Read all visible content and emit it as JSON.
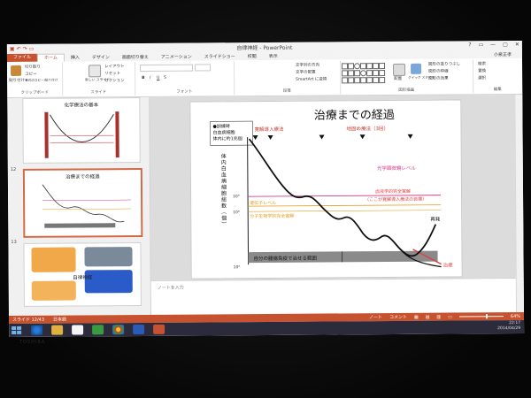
{
  "window": {
    "title": "自律神経 - PowerPoint",
    "controls": [
      "?",
      "▭",
      "—",
      "▢",
      "✕"
    ],
    "qat_icons": [
      "save-icon",
      "undo-icon",
      "redo-icon",
      "present-icon"
    ]
  },
  "tabs": [
    "ファイル",
    "ホーム",
    "挿入",
    "デザイン",
    "画面切り替え",
    "アニメーション",
    "スライドショー",
    "校閲",
    "表示"
  ],
  "active_tab": "ホーム",
  "user_name": "小泉正孝",
  "ribbon": {
    "clipboard": {
      "label": "クリップボード",
      "paste": "貼り付け",
      "cut": "切り取り",
      "copy": "コピー",
      "format_painter": "書式のコピー/貼り付け"
    },
    "slides": {
      "label": "スライド",
      "new_slide": "新しい スライド",
      "layout": "レイアウト",
      "reset": "リセット",
      "section": "セクション"
    },
    "font": {
      "label": "フォント",
      "bold": "B",
      "italic": "I",
      "underline": "U",
      "shadow": "S"
    },
    "paragraph": {
      "label": "段落",
      "text_direction": "文字列の方向",
      "align_text": "文字の配置",
      "smartart": "SmartArt に変換"
    },
    "drawing": {
      "label": "図形描画",
      "arrange": "配置",
      "quick_styles": "クイック スタイル",
      "shape_fill": "図形の塗りつぶし",
      "shape_outline": "図形の枠線",
      "shape_effects": "図形の効果"
    },
    "editing": {
      "label": "編集",
      "find": "検索",
      "replace": "置換",
      "select": "選択"
    }
  },
  "slides_panel": [
    {
      "number": "",
      "title": "化学療法の基本"
    },
    {
      "number": "12",
      "title": "治療までの経過"
    },
    {
      "number": "13",
      "title": "自律神経"
    }
  ],
  "slide": {
    "title": "治療までの経過",
    "legend_box": {
      "line1": "●訓練時",
      "line2": "白血病細胞",
      "line3": "体内に約1兆個"
    },
    "y_label": "体内白血病細胞総数（個）",
    "markers": {
      "induction": "寛解導入療法",
      "consolidation": "地固め療法（3回）"
    },
    "levels": {
      "optical": "光学顕微鏡レベル",
      "hema_complete": "血液学的完全寛解",
      "hema_complete_sub": "（ここが寛解導入療法の目標）",
      "gene_level": "遺伝子レベル",
      "molecular": "分子生物学的完全寛解"
    },
    "ticks": [
      "10¹²",
      "10⁹",
      "10⁶",
      "10⁰"
    ],
    "immune_label": "自分の腫瘍免疫で治せる範囲",
    "relapse": "再発",
    "cure": "治癒"
  },
  "notes_placeholder": "ノートを入力",
  "status": {
    "slide_info": "スライド 12/43",
    "language": "日本語",
    "notes": "ノート",
    "comments": "コメント",
    "zoom": "64%"
  },
  "tray": {
    "time": "22:17",
    "date": "2014/04/29"
  },
  "brand": "TOSHIBA",
  "colors": {
    "accent": "#c6522f",
    "dark_red": "#8b1a1a",
    "gold": "#e0a020",
    "pink": "#d63c8c",
    "red_line": "#e04040",
    "band": "#8a8a8a"
  }
}
